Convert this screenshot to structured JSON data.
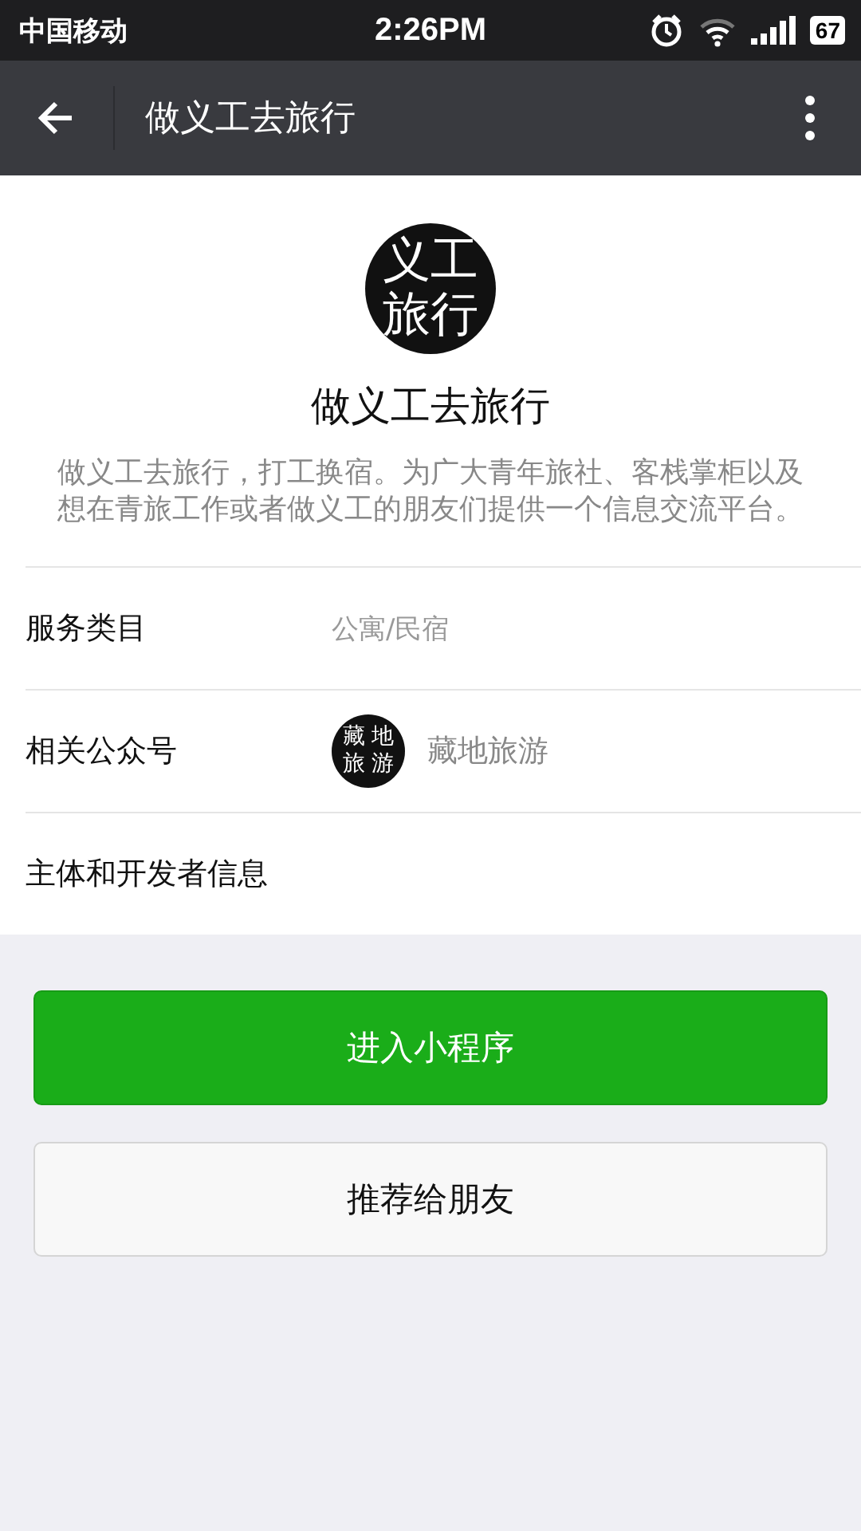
{
  "status_bar": {
    "carrier": "中国移动",
    "time": "2:26PM",
    "battery": "67"
  },
  "nav_bar": {
    "title": "做义工去旅行"
  },
  "profile": {
    "logo_lines": [
      "义工",
      "旅行"
    ],
    "name": "做义工去旅行",
    "description": "做义工去旅行，打工换宿。为广大青年旅社、客栈掌柜以及想在青旅工作或者做义工的朋友们提供一个信息交流平台。"
  },
  "info_rows": [
    {
      "kind": "text",
      "label": "服务类目",
      "value": "公寓/民宿"
    },
    {
      "kind": "account",
      "label": "相关公众号",
      "logo_lines": [
        "藏 地",
        "旅 游"
      ],
      "value": "藏地旅游"
    },
    {
      "kind": "plain",
      "label": "主体和开发者信息"
    }
  ],
  "buttons": [
    {
      "label": "进入小程序",
      "primary": true
    },
    {
      "label": "推荐给朋友",
      "primary": false
    }
  ]
}
